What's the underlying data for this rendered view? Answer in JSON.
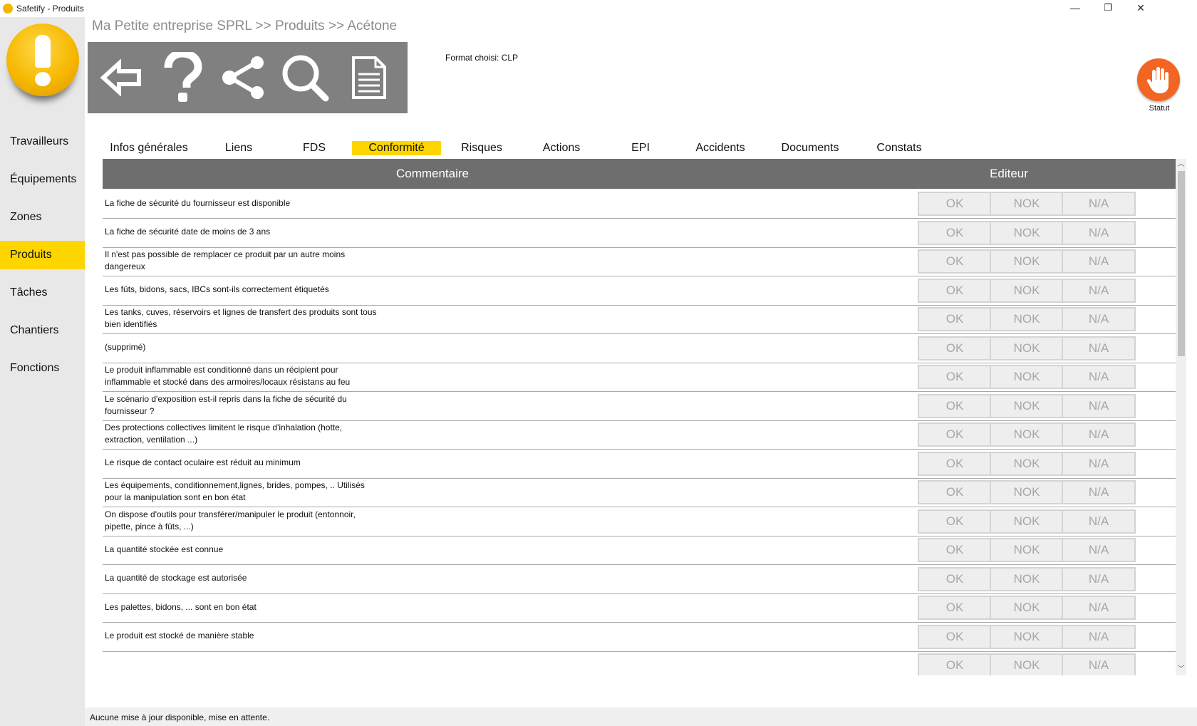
{
  "window": {
    "title": "Safetify - Produits",
    "minimize": "—",
    "restore": "❐",
    "close": "✕"
  },
  "breadcrumb": "Ma Petite entreprise SPRL >> Produits >> Acétone",
  "sidebar": {
    "logo_icon": "warning-exclamation-icon",
    "items": [
      {
        "label": "Travailleurs"
      },
      {
        "label": "Équipements"
      },
      {
        "label": "Zones"
      },
      {
        "label": "Produits",
        "active": true
      },
      {
        "label": "Tâches"
      },
      {
        "label": "Chantiers"
      },
      {
        "label": "Fonctions"
      }
    ]
  },
  "toolbar": {
    "icons": [
      "back-arrow-icon",
      "help-question-icon",
      "share-icon",
      "search-icon",
      "document-icon"
    ]
  },
  "format_label": "Format choisi: CLP",
  "status": {
    "label": "Statut",
    "icon": "hand-stop-icon",
    "color": "#f26522"
  },
  "tabs": [
    {
      "label": "Infos générales"
    },
    {
      "label": "Liens"
    },
    {
      "label": "FDS"
    },
    {
      "label": "Conformité",
      "active": true
    },
    {
      "label": "Risques"
    },
    {
      "label": "Actions"
    },
    {
      "label": "EPI"
    },
    {
      "label": "Accidents"
    },
    {
      "label": "Documents"
    },
    {
      "label": "Constats"
    }
  ],
  "table": {
    "headers": {
      "comment": "Commentaire",
      "editor": "Editeur"
    },
    "choices": [
      "OK",
      "NOK",
      "N/A"
    ],
    "rows": [
      {
        "text": "La fiche de sécurité du fournisseur est disponible"
      },
      {
        "text": "La fiche de sécurité date de moins de 3 ans"
      },
      {
        "text": "Il n'est pas possible de remplacer ce produit par un autre moins dangereux"
      },
      {
        "text": "Les fûts, bidons, sacs, IBCs sont-ils correctement étiquetés"
      },
      {
        "text": "Les tanks, cuves, réservoirs et lignes de transfert des produits sont tous bien identifiés"
      },
      {
        "text": "(supprimé)"
      },
      {
        "text": "Le produit inflammable est conditionné dans un récipient pour inflammable et stocké dans des armoires/locaux résistans au feu"
      },
      {
        "text": "Le scénario d'exposition est-il repris dans la fiche de sécurité du fournisseur ?"
      },
      {
        "text": "Des protections collectives limitent le risque d'inhalation (hotte, extraction, ventilation ...)"
      },
      {
        "text": "Le risque de contact oculaire est réduit au minimum"
      },
      {
        "text": "Les équipements, conditionnement,lignes, brides, pompes, .. Utilisés pour la manipulation sont en bon état"
      },
      {
        "text": "On dispose d'outils pour transférer/manipuler le produit (entonnoir, pipette, pince à fûts, ...)"
      },
      {
        "text": "La quantité stockée est connue"
      },
      {
        "text": "La quantité de stockage est autorisée"
      },
      {
        "text": "Les palettes, bidons, ... sont en bon état"
      },
      {
        "text": "Le produit est stocké de manière stable"
      },
      {
        "text": ""
      }
    ]
  },
  "statusbar": "Aucune mise à jour disponible, mise en attente."
}
